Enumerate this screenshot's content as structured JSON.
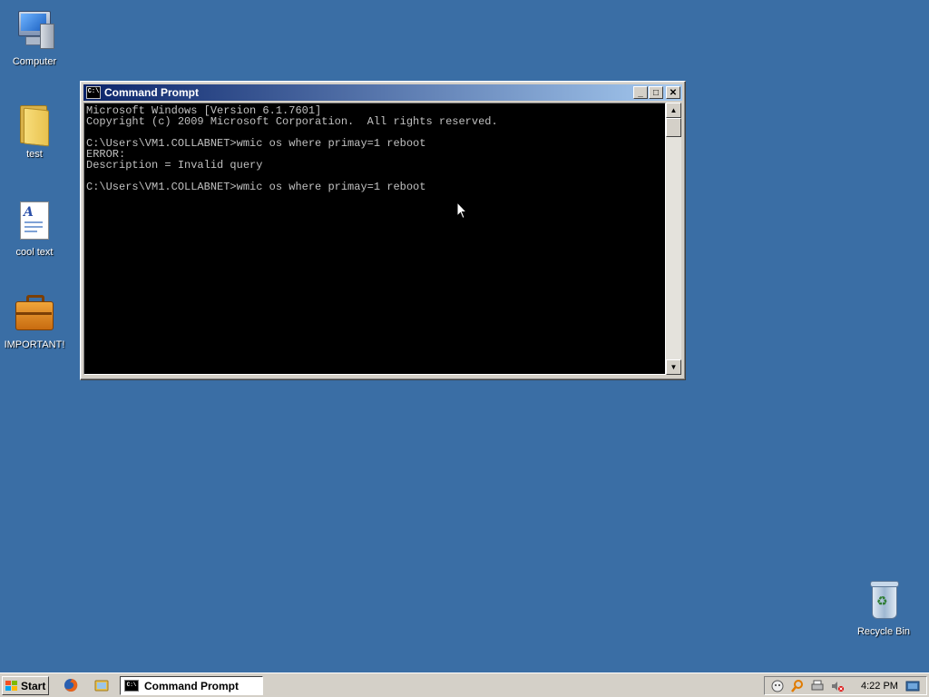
{
  "desktop": {
    "icons": [
      {
        "label": "Computer",
        "icon": "computer-icon"
      },
      {
        "label": "test",
        "icon": "folder-icon"
      },
      {
        "label": "cool text",
        "icon": "text-document-icon"
      },
      {
        "label": "IMPORTANT!",
        "icon": "briefcase-icon"
      },
      {
        "label": "Recycle Bin",
        "icon": "recycle-bin-icon"
      }
    ],
    "background_color": "#3a6ea5"
  },
  "window": {
    "title": "Command Prompt",
    "icon_text": "C:\\",
    "buttons": {
      "minimize": "_",
      "maximize": "□",
      "close": "✕"
    },
    "console_lines": [
      "Microsoft Windows [Version 6.1.7601]",
      "Copyright (c) 2009 Microsoft Corporation.  All rights reserved.",
      "",
      "C:\\Users\\VM1.COLLABNET>wmic os where primay=1 reboot",
      "ERROR:",
      "Description = Invalid query",
      "",
      "C:\\Users\\VM1.COLLABNET>wmic os where primay=1 reboot"
    ],
    "scroll_up": "▲",
    "scroll_down": "▼"
  },
  "taskbar": {
    "start_label": "Start",
    "quick_launch": [
      "firefox-icon",
      "file-explorer-icon"
    ],
    "task_buttons": [
      {
        "label": "Command Prompt",
        "icon": "command-prompt-icon"
      }
    ],
    "tray_icons": [
      "network-monitor-icon",
      "search-tray-icon",
      "printer-icon",
      "volume-muted-icon"
    ],
    "clock": "4:22 PM",
    "show_desktop_icon": "show-desktop-icon"
  }
}
